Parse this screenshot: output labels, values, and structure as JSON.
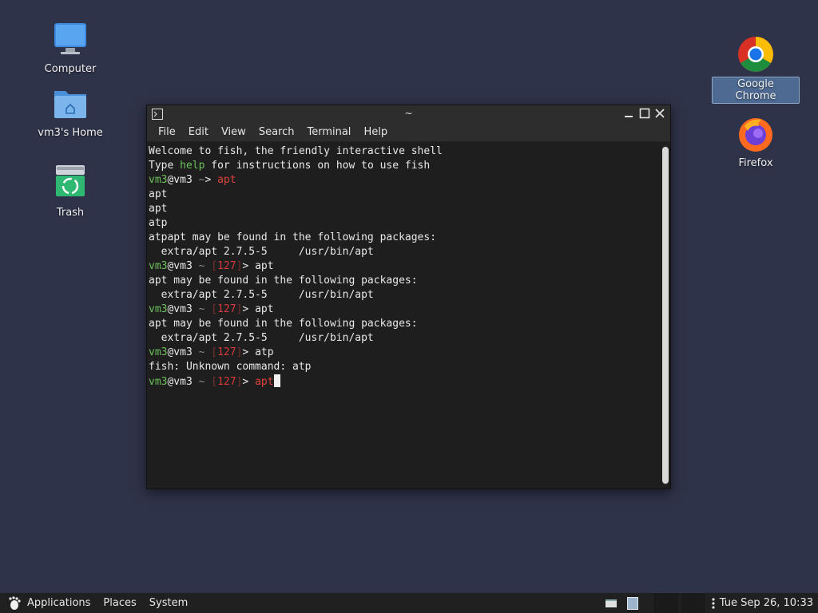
{
  "desktop": {
    "icons": [
      {
        "label": "Computer",
        "icon": "computer-icon"
      },
      {
        "label": "vm3's Home",
        "icon": "home-folder-icon"
      },
      {
        "label": "Trash",
        "icon": "trash-icon"
      },
      {
        "label": "Google Chrome",
        "icon": "chrome-icon",
        "selected": true
      },
      {
        "label": "Firefox",
        "icon": "firefox-icon"
      }
    ]
  },
  "window": {
    "title": "~",
    "menu": [
      "File",
      "Edit",
      "View",
      "Search",
      "Terminal",
      "Help"
    ]
  },
  "terminal": {
    "lines": [
      [
        {
          "t": "Welcome to fish, the friendly interactive shell"
        }
      ],
      [
        {
          "t": "Type "
        },
        {
          "t": "help",
          "c": "green"
        },
        {
          "t": " for instructions on how to use fish"
        }
      ],
      [
        {
          "t": "vm3",
          "c": "green"
        },
        {
          "t": "@vm3 "
        },
        {
          "t": "~",
          "c": "grey"
        },
        {
          "t": "> "
        },
        {
          "t": "apt",
          "c": "red"
        }
      ],
      [
        {
          "t": "apt"
        }
      ],
      [
        {
          "t": "apt"
        }
      ],
      [
        {
          "t": "atp"
        }
      ],
      [
        {
          "t": "atpapt may be found in the following packages:"
        }
      ],
      [
        {
          "t": "  extra/apt 2.7.5-5     /usr/bin/apt"
        }
      ],
      [
        {
          "t": "vm3",
          "c": "green"
        },
        {
          "t": "@vm3 "
        },
        {
          "t": "~",
          "c": "grey"
        },
        {
          "t": " "
        },
        {
          "t": "[",
          "c": "dim"
        },
        {
          "t": "127",
          "c": "err"
        },
        {
          "t": "]",
          "c": "dim"
        },
        {
          "t": "> apt"
        }
      ],
      [
        {
          "t": "apt may be found in the following packages:"
        }
      ],
      [
        {
          "t": "  extra/apt 2.7.5-5     /usr/bin/apt"
        }
      ],
      [
        {
          "t": "vm3",
          "c": "green"
        },
        {
          "t": "@vm3 "
        },
        {
          "t": "~",
          "c": "grey"
        },
        {
          "t": " "
        },
        {
          "t": "[",
          "c": "dim"
        },
        {
          "t": "127",
          "c": "err"
        },
        {
          "t": "]",
          "c": "dim"
        },
        {
          "t": "> apt"
        }
      ],
      [
        {
          "t": "apt may be found in the following packages:"
        }
      ],
      [
        {
          "t": "  extra/apt 2.7.5-5     /usr/bin/apt"
        }
      ],
      [
        {
          "t": "vm3",
          "c": "green"
        },
        {
          "t": "@vm3 "
        },
        {
          "t": "~",
          "c": "grey"
        },
        {
          "t": " "
        },
        {
          "t": "[",
          "c": "dim"
        },
        {
          "t": "127",
          "c": "err"
        },
        {
          "t": "]",
          "c": "dim"
        },
        {
          "t": "> atp"
        }
      ],
      [
        {
          "t": "fish: Unknown command: atp"
        }
      ],
      [
        {
          "t": "vm3",
          "c": "green"
        },
        {
          "t": "@vm3 "
        },
        {
          "t": "~",
          "c": "grey"
        },
        {
          "t": " "
        },
        {
          "t": "[",
          "c": "dim"
        },
        {
          "t": "127",
          "c": "err"
        },
        {
          "t": "]",
          "c": "dim"
        },
        {
          "t": "> "
        },
        {
          "t": "apt",
          "c": "red"
        },
        {
          "cursor": true
        }
      ]
    ]
  },
  "taskbar": {
    "applications": "Applications",
    "places": "Places",
    "system": "System",
    "clock": "Tue Sep 26, 10:33"
  },
  "colors": {
    "desktop_bg": "#2f3349",
    "prompt_green": "#6bbf5a",
    "command_red": "#e0443c",
    "status_red": "#d9393a"
  }
}
